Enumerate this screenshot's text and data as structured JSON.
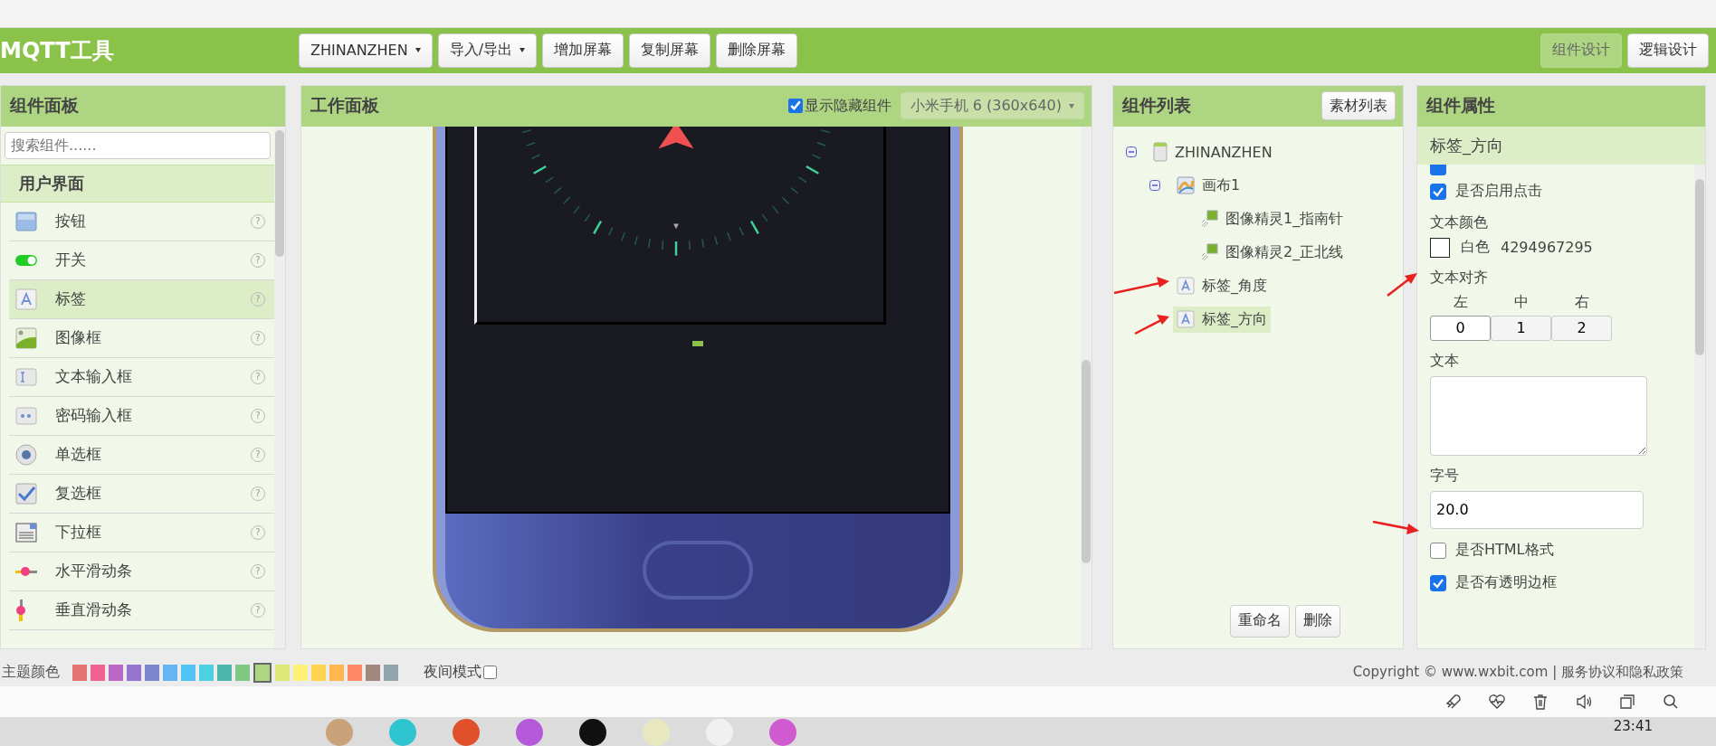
{
  "app": {
    "title": "MQTT工具"
  },
  "toolbar": {
    "buttons": [
      {
        "label": "ZHINANZHEN",
        "kind": "dropdown"
      },
      {
        "label": "导入/导出",
        "kind": "dropdown"
      },
      {
        "label": "增加屏幕",
        "kind": "button"
      },
      {
        "label": "复制屏幕",
        "kind": "button"
      },
      {
        "label": "删除屏幕",
        "kind": "button"
      }
    ],
    "views": [
      {
        "label": "组件设计",
        "selected": true
      },
      {
        "label": "逻辑设计",
        "selected": false
      }
    ]
  },
  "palette": {
    "title": "组件面板",
    "placeholder": "搜索组件......",
    "category": "用户界面",
    "items": [
      {
        "label": "按钮",
        "kind": "button",
        "help": "?",
        "selected": false
      },
      {
        "label": "开关",
        "kind": "switch",
        "help": "?",
        "selected": false
      },
      {
        "label": "标签",
        "kind": "label",
        "help": "?",
        "selected": true
      },
      {
        "label": "图像框",
        "kind": "image",
        "help": "?",
        "selected": false
      },
      {
        "label": "文本输入框",
        "kind": "textbox",
        "help": "?",
        "selected": false
      },
      {
        "label": "密码输入框",
        "kind": "password",
        "help": "?",
        "selected": false
      },
      {
        "label": "单选框",
        "kind": "radio",
        "help": "?",
        "selected": false
      },
      {
        "label": "复选框",
        "kind": "checkbox",
        "help": "?",
        "selected": false
      },
      {
        "label": "下拉框",
        "kind": "dropdown",
        "help": "?",
        "selected": false
      },
      {
        "label": "水平滑动条",
        "kind": "hslider",
        "help": "?",
        "selected": false
      },
      {
        "label": "垂直滑动条",
        "kind": "vslider",
        "help": "?",
        "selected": false
      }
    ]
  },
  "workspace": {
    "title": "工作面板",
    "show_hidden": {
      "label": "显示隐藏组件",
      "checked": true
    },
    "device": "小米手机 6 (360x640)"
  },
  "components": {
    "title": "组件列表",
    "assets_button": "素材列表",
    "tree": [
      {
        "label": "ZHINANZHEN",
        "kind": "screen",
        "expanded": true,
        "selected": false,
        "children": [
          {
            "label": "画布1",
            "kind": "canvas",
            "expanded": true,
            "selected": false,
            "children": [
              {
                "label": "图像精灵1_指南针",
                "kind": "sprite",
                "selected": false
              },
              {
                "label": "图像精灵2_正北线",
                "kind": "sprite",
                "selected": false
              }
            ]
          },
          {
            "label": "标签_角度",
            "kind": "label",
            "selected": false
          },
          {
            "label": "标签_方向",
            "kind": "label",
            "selected": true
          }
        ]
      }
    ],
    "buttons": [
      "重命名",
      "删除"
    ]
  },
  "properties": {
    "title": "组件属性",
    "component": "标签_方向",
    "fields": [
      {
        "kind": "cut_checkbox",
        "checked": true
      },
      {
        "kind": "checkbox",
        "label": "是否启用点击",
        "checked": true
      },
      {
        "kind": "color",
        "label": "文本颜色",
        "color_name": "白色",
        "value": "4294967295"
      },
      {
        "kind": "align",
        "label": "文本对齐",
        "options": [
          {
            "caption": "左",
            "value": "0",
            "selected": true
          },
          {
            "caption": "中",
            "value": "1",
            "selected": false
          },
          {
            "caption": "右",
            "value": "2",
            "selected": false
          }
        ]
      },
      {
        "kind": "textarea",
        "label": "文本"
      },
      {
        "kind": "input",
        "label": "字号",
        "value": "20.0"
      },
      {
        "kind": "checkbox",
        "label": "是否HTML格式",
        "checked": false
      },
      {
        "kind": "checkbox",
        "label": "是否有透明边框",
        "checked": true
      }
    ]
  },
  "footer": {
    "theme_label": "主题颜色",
    "themes": [
      {
        "color": "#e57373",
        "selected": false
      },
      {
        "color": "#f06292",
        "selected": false
      },
      {
        "color": "#ba68c8",
        "selected": false
      },
      {
        "color": "#9575cd",
        "selected": false
      },
      {
        "color": "#7986cb",
        "selected": false
      },
      {
        "color": "#64b5f6",
        "selected": false
      },
      {
        "color": "#4fc3f7",
        "selected": false
      },
      {
        "color": "#4dd0e1",
        "selected": false
      },
      {
        "color": "#4db6ac",
        "selected": false
      },
      {
        "color": "#81c784",
        "selected": false
      },
      {
        "color": "#aed581",
        "selected": true
      },
      {
        "color": "#dce775",
        "selected": false
      },
      {
        "color": "#fff176",
        "selected": false
      },
      {
        "color": "#ffd54f",
        "selected": false
      },
      {
        "color": "#ffb74d",
        "selected": false
      },
      {
        "color": "#ff8a65",
        "selected": false
      },
      {
        "color": "#a1887f",
        "selected": false
      },
      {
        "color": "#90a4ae",
        "selected": false
      }
    ],
    "night_mode": {
      "label": "夜间模式",
      "checked": false
    },
    "copyright": "Copyright © www.wxbit.com | 服务协议和隐私政策"
  },
  "taskbar": {
    "time": "23:41"
  }
}
